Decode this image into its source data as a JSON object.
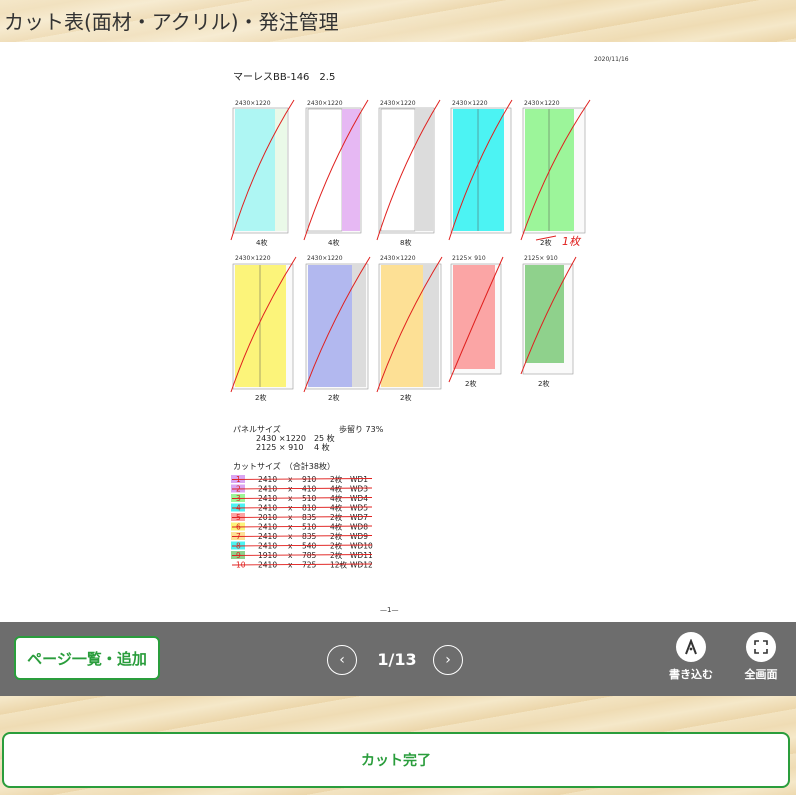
{
  "header": {
    "title": "カット表(面材・アクリル)・発注管理"
  },
  "document": {
    "date": "2020/11/16",
    "doc_title": "マーレスBB-146　2.5",
    "page_footer": "—1—",
    "panels_row1": [
      {
        "size": "2430×1220",
        "count": "4枚"
      },
      {
        "size": "2430×1220",
        "count": "4枚"
      },
      {
        "size": "2430×1220",
        "count": "8枚"
      },
      {
        "size": "2430×1220",
        "count": ""
      },
      {
        "size": "2430×1220",
        "count": "2枚"
      }
    ],
    "panels_row2": [
      {
        "size": "2430×1220",
        "count": "2枚"
      },
      {
        "size": "2430×1220",
        "count": "2枚"
      },
      {
        "size": "2430×1220",
        "count": "2枚"
      },
      {
        "size": "2125× 910",
        "count": "2枚"
      },
      {
        "size": "2125× 910",
        "count": "2枚"
      }
    ],
    "handwritten_count": "1枚",
    "panel_size_heading": "パネルサイズ",
    "yield_label": "歩留り 73%",
    "panel_size_lines": [
      "2430 ×1220　25 枚",
      "2125 × 910　 4 枚"
    ],
    "cut_size_heading": "カットサイズ　（合計38枚）",
    "cut_rows": [
      {
        "no": "1",
        "a": "2410",
        "b": "910",
        "qty": "2枚",
        "code": "WD1"
      },
      {
        "no": "2",
        "a": "2410",
        "b": "410",
        "qty": "4枚",
        "code": "WD3"
      },
      {
        "no": "3",
        "a": "2410",
        "b": "510",
        "qty": "4枚",
        "code": "WD4"
      },
      {
        "no": "4",
        "a": "2410",
        "b": "810",
        "qty": "4枚",
        "code": "WD5"
      },
      {
        "no": "5",
        "a": "2010",
        "b": "835",
        "qty": "2枚",
        "code": "WD7"
      },
      {
        "no": "6",
        "a": "2410",
        "b": "510",
        "qty": "4枚",
        "code": "WD8"
      },
      {
        "no": "7",
        "a": "2410",
        "b": "835",
        "qty": "2枚",
        "code": "WD9"
      },
      {
        "no": "8",
        "a": "2410",
        "b": "540",
        "qty": "2枚",
        "code": "WD10"
      },
      {
        "no": "9",
        "a": "1910",
        "b": "785",
        "qty": "2枚",
        "code": "WD11"
      },
      {
        "no": "10",
        "a": "2410",
        "b": "725",
        "qty": "12枚",
        "code": "WD12"
      }
    ],
    "cut_separator": "x"
  },
  "viewer": {
    "page_list_label": "ページ一覧・追加",
    "page_indicator": "1/13",
    "prev_icon": "chevron-left-icon",
    "next_icon": "chevron-right-icon",
    "write_label": "書き込む",
    "fullscreen_label": "全画面"
  },
  "footer": {
    "complete_label": "カット完了"
  },
  "colors": {
    "accent_green": "#2a9d3c",
    "viewer_bar": "#6d6d6d",
    "annotation_red": "#e0201e"
  }
}
